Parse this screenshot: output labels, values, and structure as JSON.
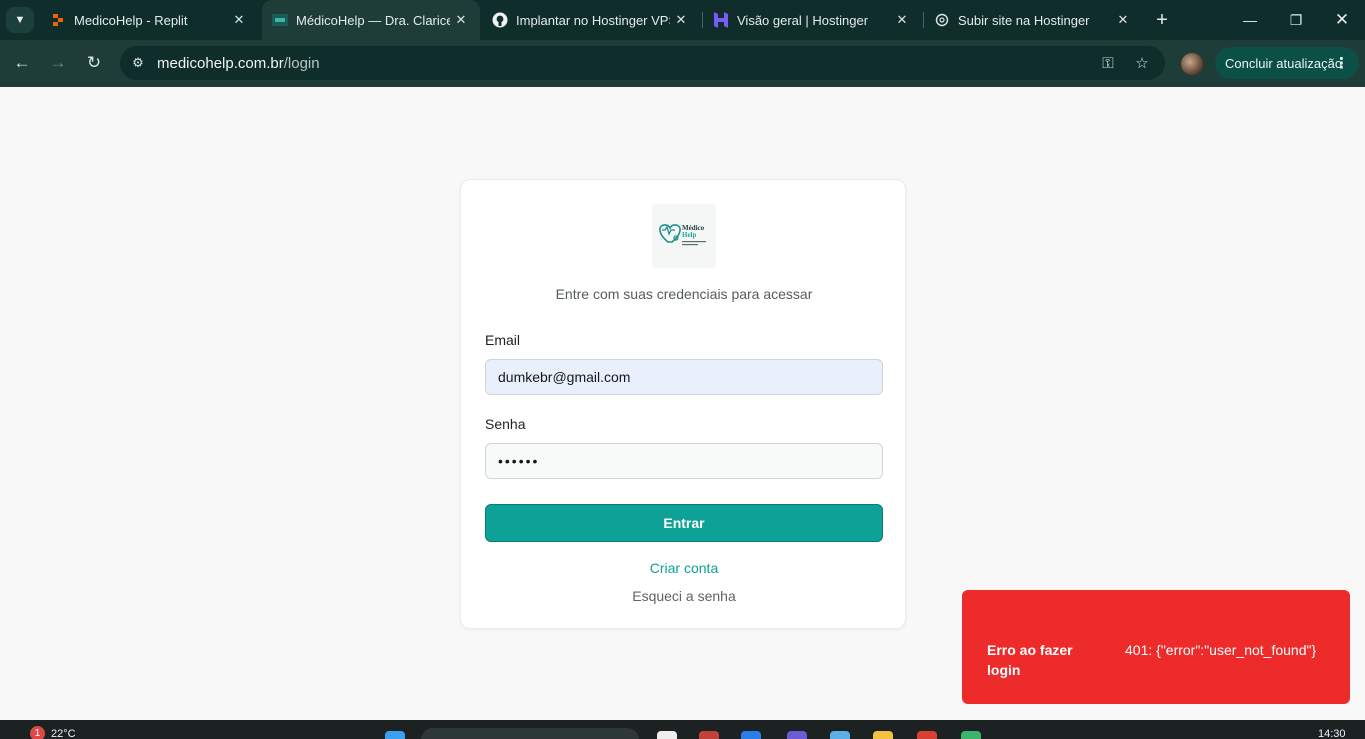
{
  "browser": {
    "tabs": [
      {
        "title": "MedicoHelp - Replit",
        "icon": "replit-icon",
        "active": false
      },
      {
        "title": "MédicoHelp — Dra. Clarice",
        "icon": "medicohelp-favicon",
        "active": true
      },
      {
        "title": "Implantar no Hostinger VPS",
        "icon": "github-icon",
        "active": false
      },
      {
        "title": "Visão geral | Hostinger",
        "icon": "hostinger-icon",
        "active": false
      },
      {
        "title": "Subir site na Hostinger",
        "icon": "chatgpt-icon",
        "active": false
      }
    ],
    "url_host": "medicohelp.com.br",
    "url_path": "/login",
    "update_button": "Concluir atualização"
  },
  "login": {
    "logo_text": "Médico",
    "logo_text2": "Help",
    "subtitle": "Entre com suas credenciais para acessar",
    "email_label": "Email",
    "email_value": "dumkebr@gmail.com",
    "password_label": "Senha",
    "password_value": "••••••",
    "submit_label": "Entrar",
    "create_account": "Criar conta",
    "forgot_password": "Esqueci a senha"
  },
  "toast": {
    "title": "Erro ao fazer login",
    "message": "401: {\"error\":\"user_not_found\"}"
  },
  "taskbar": {
    "weather_badge": "1",
    "temperature": "22°C",
    "clock": "14:30"
  },
  "colors": {
    "accent": "#0ea197",
    "error": "#ee2b2b",
    "chrome": "#0f2d2a"
  }
}
